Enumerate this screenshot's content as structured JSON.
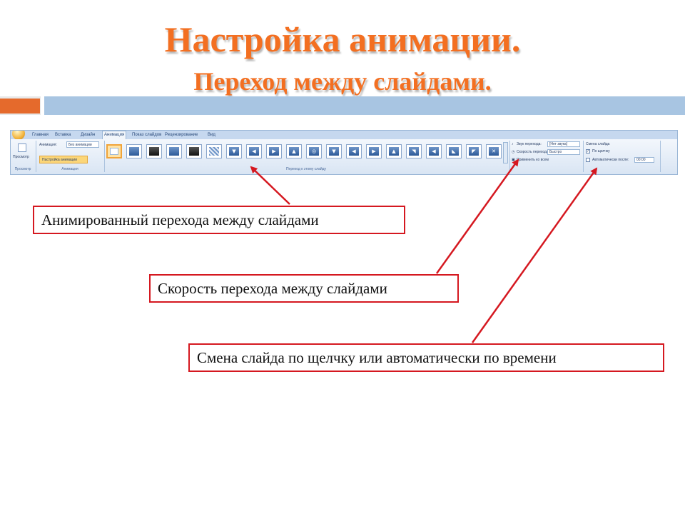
{
  "slide": {
    "title_line1": "Настройка анимации.",
    "title_line2": "Переход между слайдами."
  },
  "ribbon": {
    "tabs": [
      "Главная",
      "Вставка",
      "Дизайн",
      "Анимация",
      "Показ слайдов",
      "Рецензирование",
      "Вид"
    ],
    "active_tab": "Анимация",
    "preview_label": "Просмотр",
    "preview_group_label": "Просмотр",
    "animation_label": "Анимация:",
    "animation_value": "Без анимации",
    "custom_animation_label": "Настройка анимации",
    "animation_group_label": "Анимация",
    "transition_group_label": "Переход к этому слайду",
    "sound_label": "Звук перехода:",
    "sound_value": "[Нет звука]",
    "speed_label": "Скорость перехода:",
    "speed_value": "Быстро",
    "apply_all_label": "Применить ко всем",
    "advance_header": "Смена слайда",
    "on_click_label": "По щелчку",
    "auto_after_label": "Автоматически после:",
    "auto_after_value": "00:00"
  },
  "callouts": {
    "animated_transition": "Анимированный перехода между слайдами",
    "transition_speed": "Скорость перехода между слайдами",
    "slide_advance": "Смена слайда по щелчку или автоматически по времени"
  },
  "colors": {
    "title": "#f36f21",
    "callout_border": "#d51820",
    "arrow": "#d51820",
    "band_blue": "#a8c5e2",
    "band_orange": "#e56a2c"
  }
}
